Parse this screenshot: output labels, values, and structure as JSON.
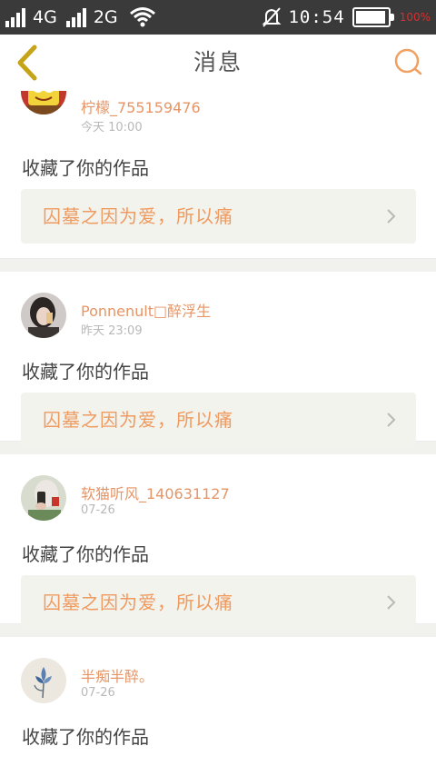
{
  "status_bar": {
    "network1": "4G",
    "network2": "2G",
    "time": "10:54",
    "battery_level": 0.95,
    "battery_text": "100%",
    "battery_text_color": "#d43030"
  },
  "header": {
    "title": "消息",
    "back_icon": "chevron-left-icon",
    "search_icon": "search-icon",
    "accent_color": "#f0a060"
  },
  "messages": [
    {
      "username": "柠檬_755159476",
      "time": "今天 10:00",
      "action": "收藏了你的作品",
      "work_title": "囚墓之因为爱，所以痛"
    },
    {
      "username": "Ponnenult□醉浮生",
      "time": "昨天 23:09",
      "action": "收藏了你的作品",
      "work_title": "囚墓之因为爱，所以痛"
    },
    {
      "username": "软猫听风_140631127",
      "time": "07-26",
      "action": "收藏了你的作品",
      "work_title": "囚墓之因为爱，所以痛"
    },
    {
      "username": "半痴半醉。",
      "time": "07-26",
      "action": "收藏了你的作品",
      "work_title": ""
    }
  ]
}
